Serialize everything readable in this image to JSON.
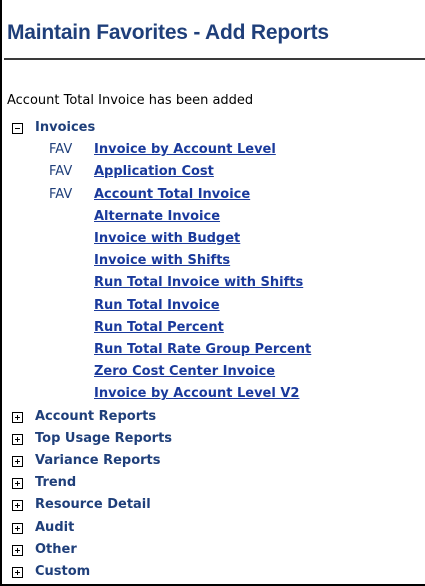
{
  "header": {
    "title": "Maintain Favorites - Add Reports"
  },
  "status_message": "Account Total Invoice has been added",
  "expanded_category": {
    "label": "Invoices",
    "state": "collapse",
    "reports": [
      {
        "fav": "FAV",
        "label": "Invoice by Account Level"
      },
      {
        "fav": "FAV",
        "label": "Application Cost"
      },
      {
        "fav": "FAV",
        "label": "Account Total Invoice"
      },
      {
        "fav": "",
        "label": "Alternate Invoice"
      },
      {
        "fav": "",
        "label": "Invoice with Budget"
      },
      {
        "fav": "",
        "label": "Invoice with Shifts"
      },
      {
        "fav": "",
        "label": "Run Total Invoice with Shifts"
      },
      {
        "fav": "",
        "label": "Run Total Invoice"
      },
      {
        "fav": "",
        "label": "Run Total Percent"
      },
      {
        "fav": "",
        "label": "Run Total Rate Group Percent"
      },
      {
        "fav": "",
        "label": "Zero Cost Center Invoice"
      },
      {
        "fav": "",
        "label": "Invoice by Account Level V2"
      }
    ]
  },
  "collapsed_categories": [
    {
      "label": "Account Reports",
      "state": "expand"
    },
    {
      "label": "Top Usage Reports",
      "state": "expand"
    },
    {
      "label": "Variance Reports",
      "state": "expand"
    },
    {
      "label": "Trend",
      "state": "expand"
    },
    {
      "label": "Resource Detail",
      "state": "expand"
    },
    {
      "label": "Audit",
      "state": "expand"
    },
    {
      "label": "Other",
      "state": "expand"
    },
    {
      "label": "Custom",
      "state": "expand"
    }
  ],
  "colors": {
    "title": "#1f3f7a",
    "link": "#1a3a9c",
    "category": "#1f3f7a"
  }
}
